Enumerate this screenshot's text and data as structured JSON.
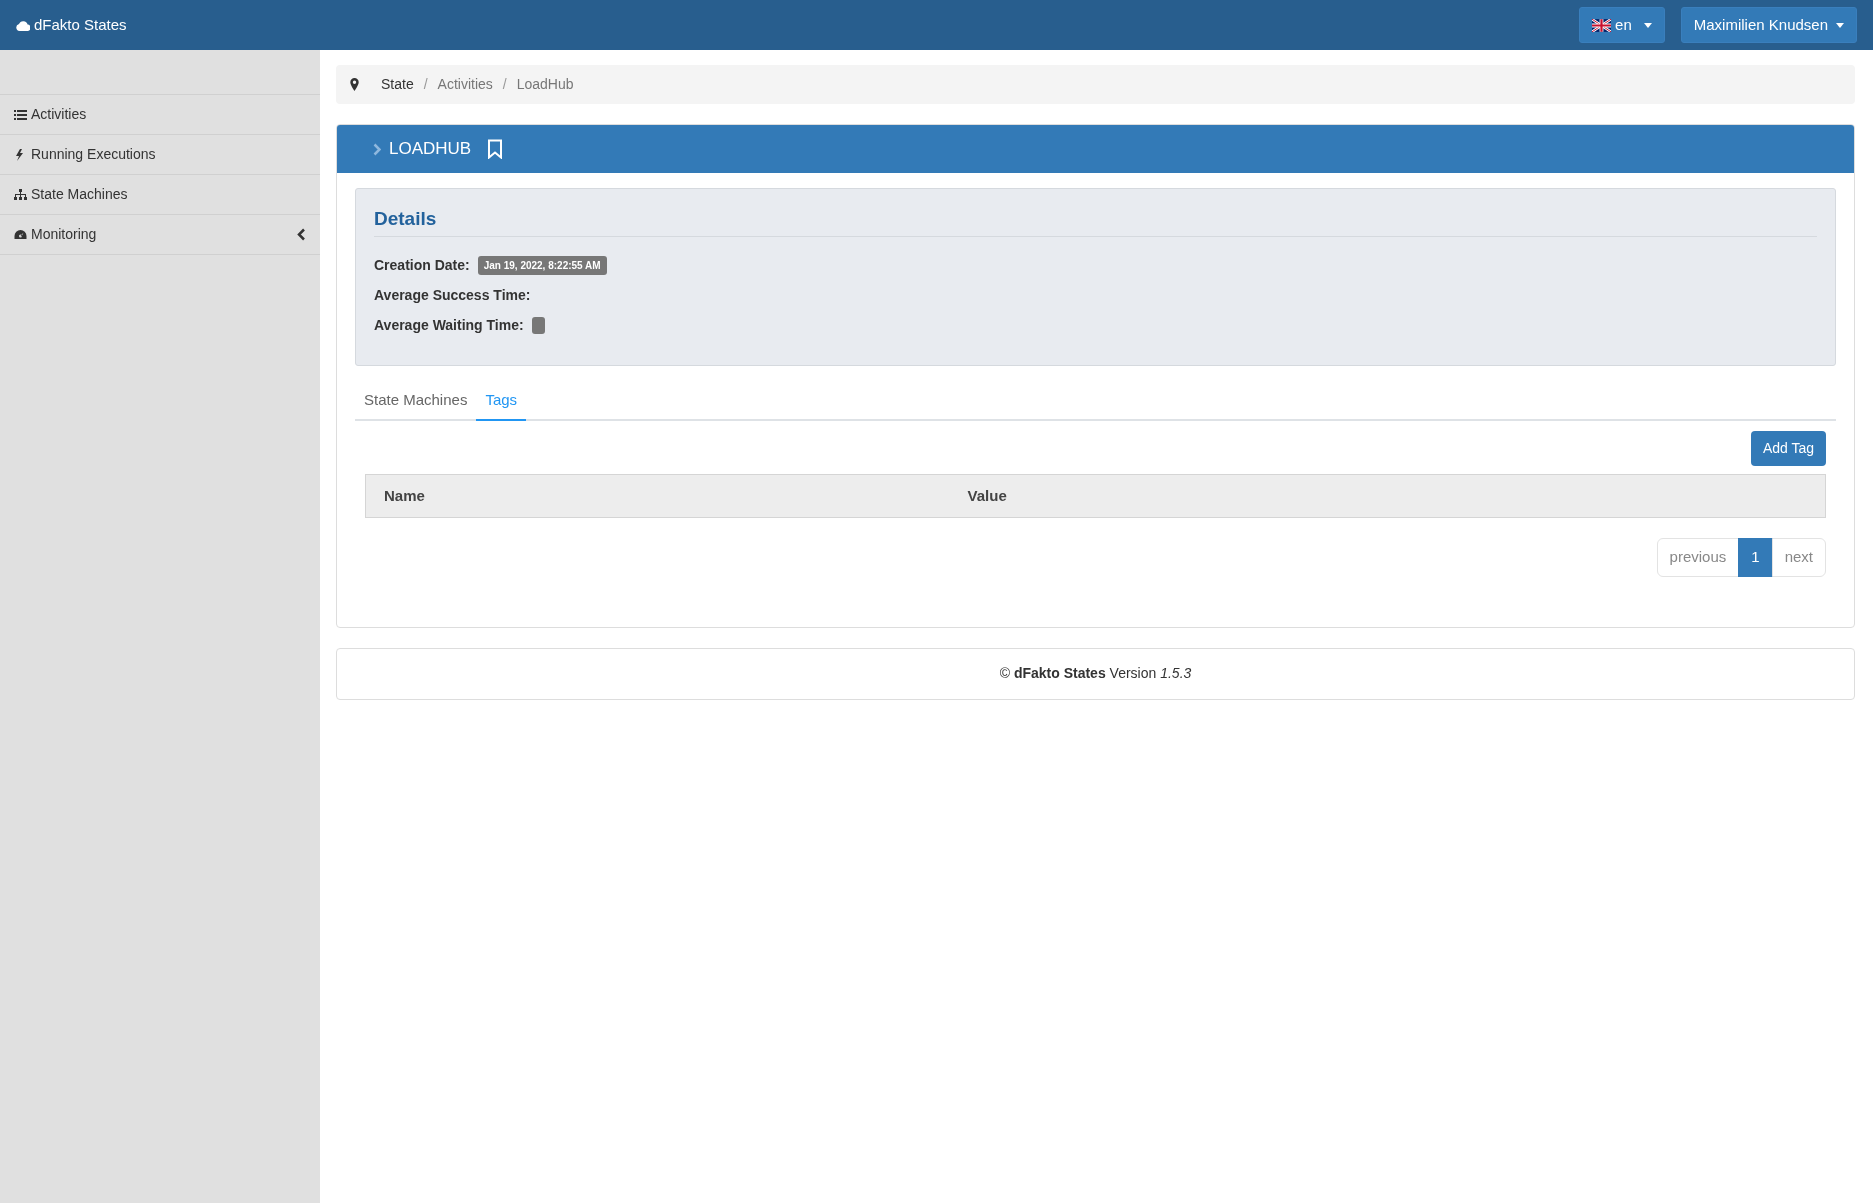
{
  "navbar": {
    "brand": "dFakto States",
    "language": "en",
    "user": "Maximilien Knudsen"
  },
  "sidebar": {
    "items": [
      {
        "label": "Activities",
        "expandable": false
      },
      {
        "label": "Running Executions",
        "expandable": false
      },
      {
        "label": "State Machines",
        "expandable": false
      },
      {
        "label": "Monitoring",
        "expandable": true
      }
    ]
  },
  "breadcrumb": {
    "separator": "/",
    "items": [
      "State",
      "Activities",
      "LoadHub"
    ]
  },
  "panel": {
    "title": "LOADHUB",
    "details": {
      "heading": "Details",
      "fields": [
        {
          "label": "Creation Date:",
          "kind": "badge",
          "value": "Jan 19, 2022, 8:22:55 AM"
        },
        {
          "label": "Average Success Time:",
          "kind": "plain"
        },
        {
          "label": "Average Waiting Time:",
          "kind": "badge"
        }
      ]
    },
    "tabs": [
      {
        "label": "State Machines",
        "selected": false
      },
      {
        "label": "Tags",
        "selected": true
      }
    ],
    "add_button": "Add Tag",
    "table": {
      "columns": [
        "Name",
        "Value"
      ]
    },
    "pagination": {
      "previous": "previous",
      "pages": [
        {
          "label": "1",
          "selected": true
        }
      ],
      "next": "next"
    }
  },
  "footer": "© **dFakto States** Version *1.5.3*"
}
